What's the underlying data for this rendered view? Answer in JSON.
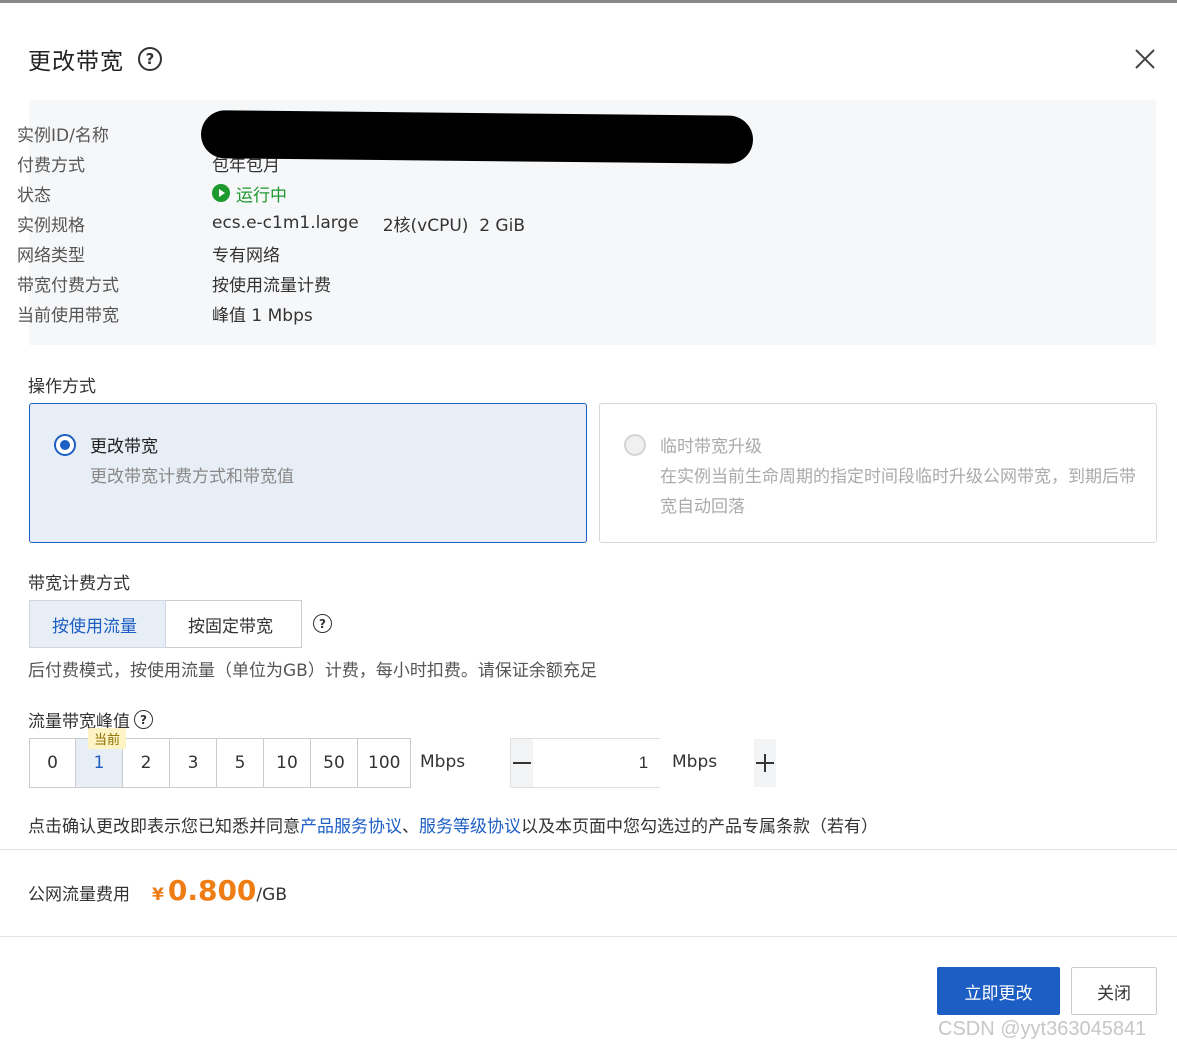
{
  "dialog": {
    "title": "更改带宽",
    "help_glyph": "?"
  },
  "instance_info": {
    "rows": [
      {
        "label": "实例ID/名称",
        "value": ""
      },
      {
        "label": "付费方式",
        "value": "包年包月"
      },
      {
        "label": "状态",
        "value": "运行中"
      },
      {
        "label": "实例规格",
        "value": "ecs.e-c1m1.large",
        "value2": "2核(vCPU)  2 GiB"
      },
      {
        "label": "网络类型",
        "value": "专有网络"
      },
      {
        "label": "带宽付费方式",
        "value": "按使用流量计费"
      },
      {
        "label": "当前使用带宽",
        "value": "峰值 1 Mbps"
      }
    ],
    "status_color": "#1c9a2e"
  },
  "operation": {
    "label": "操作方式",
    "options": [
      {
        "title": "更改带宽",
        "desc": "更改带宽计费方式和带宽值",
        "selected": true,
        "disabled": false
      },
      {
        "title": "临时带宽升级",
        "desc": "在实例当前生命周期的指定时间段临时升级公网带宽，到期后带宽自动回落",
        "selected": false,
        "disabled": true
      }
    ]
  },
  "billing": {
    "label": "带宽计费方式",
    "options": [
      "按使用流量",
      "按固定带宽"
    ],
    "selected": "按使用流量",
    "note": "后付费模式，按使用流量（单位为GB）计费，每小时扣费。请保证余额充足"
  },
  "bandwidth": {
    "label": "流量带宽峰值",
    "presets": [
      "0",
      "1",
      "2",
      "3",
      "5",
      "10",
      "50",
      "100"
    ],
    "selected": "1",
    "current_tag": "当前",
    "unit": "Mbps",
    "stepper_value": "1",
    "stepper_unit": "Mbps"
  },
  "agreement": {
    "prefix": "点击确认更改即表示您已知悉并同意",
    "link1": "产品服务协议",
    "sep": "、",
    "link2": "服务等级协议",
    "suffix": "以及本页面中您勾选过的产品专属条款（若有）"
  },
  "fee": {
    "label": "公网流量费用",
    "currency": "¥",
    "price": "0.800",
    "unit": "/GB",
    "price_color": "#f07c14"
  },
  "actions": {
    "confirm": "立即更改",
    "close": "关闭"
  },
  "watermark": "CSDN @yyt363045841",
  "accent_color": "#1c5ec4"
}
